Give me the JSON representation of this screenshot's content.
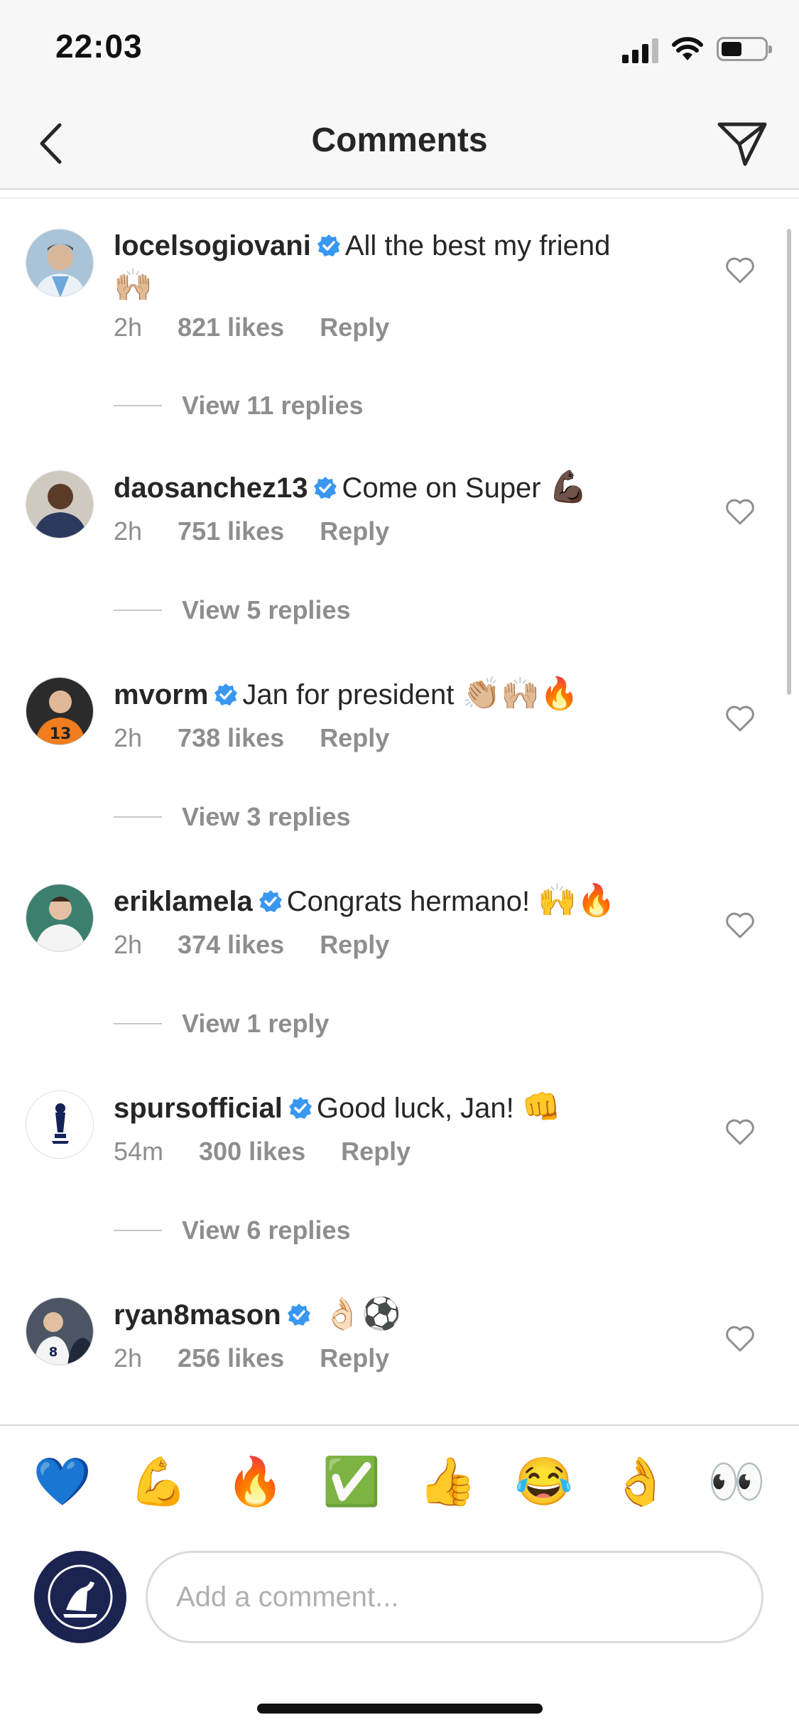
{
  "status_bar": {
    "time": "22:03"
  },
  "header": {
    "title": "Comments"
  },
  "comments": [
    {
      "username": "locelsogiovani",
      "text": "All the best my friend",
      "emoji": "🙌🏼",
      "time": "2h",
      "likes": "821 likes",
      "reply": "Reply",
      "view_replies": "View 11 replies"
    },
    {
      "username": "daosanchez13",
      "text": "Come on Super",
      "emoji": "💪🏿",
      "time": "2h",
      "likes": "751 likes",
      "reply": "Reply",
      "view_replies": "View 5 replies"
    },
    {
      "username": "mvorm",
      "text": "Jan for president",
      "emoji": "👏🏼🙌🏼🔥",
      "time": "2h",
      "likes": "738 likes",
      "reply": "Reply",
      "view_replies": "View 3 replies"
    },
    {
      "username": "eriklamela",
      "text": "Congrats hermano!",
      "emoji": "🙌🔥",
      "time": "2h",
      "likes": "374 likes",
      "reply": "Reply",
      "view_replies": "View 1 reply"
    },
    {
      "username": "spursofficial",
      "text": "Good luck, Jan!",
      "emoji": "👊",
      "time": "54m",
      "likes": "300 likes",
      "reply": "Reply",
      "view_replies": "View 6 replies"
    },
    {
      "username": "ryan8mason",
      "text": "",
      "emoji": "👌🏻⚽",
      "time": "2h",
      "likes": "256 likes",
      "reply": "Reply",
      "view_replies": ""
    }
  ],
  "quick_emojis": [
    "💙",
    "💪",
    "🔥",
    "✅",
    "👍",
    "😂",
    "👌",
    "👀"
  ],
  "composer": {
    "placeholder": "Add a comment..."
  },
  "colors": {
    "verified": "#3897f0",
    "meta_text": "#8e8e8e",
    "composer_avatar_bg": "#1b2450"
  }
}
